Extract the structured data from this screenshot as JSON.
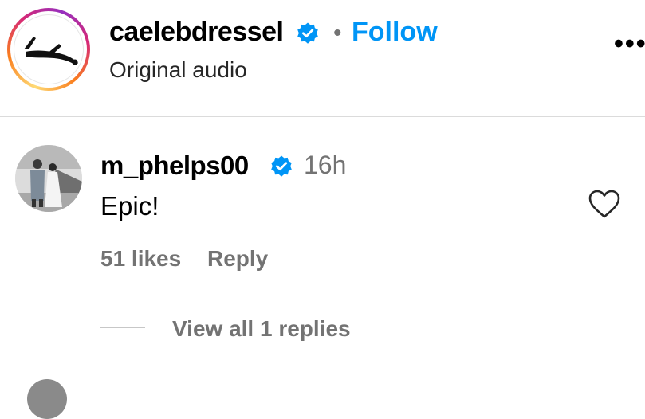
{
  "header": {
    "username": "caelebdressel",
    "separator": "•",
    "follow_label": "Follow",
    "subtitle": "Original audio",
    "more_label": "•••"
  },
  "comment": {
    "username": "m_phelps00",
    "time": "16h",
    "text": "Epic!",
    "likes": "51 likes",
    "reply_label": "Reply",
    "view_replies": "View all 1 replies"
  },
  "colors": {
    "accent": "#0095f6",
    "verified": "#0095f6",
    "muted": "#737373",
    "divider": "#dbdbdb"
  },
  "icons": {
    "verified": "verified-badge-icon",
    "heart": "heart-outline-icon",
    "more": "more-horizontal-icon"
  }
}
